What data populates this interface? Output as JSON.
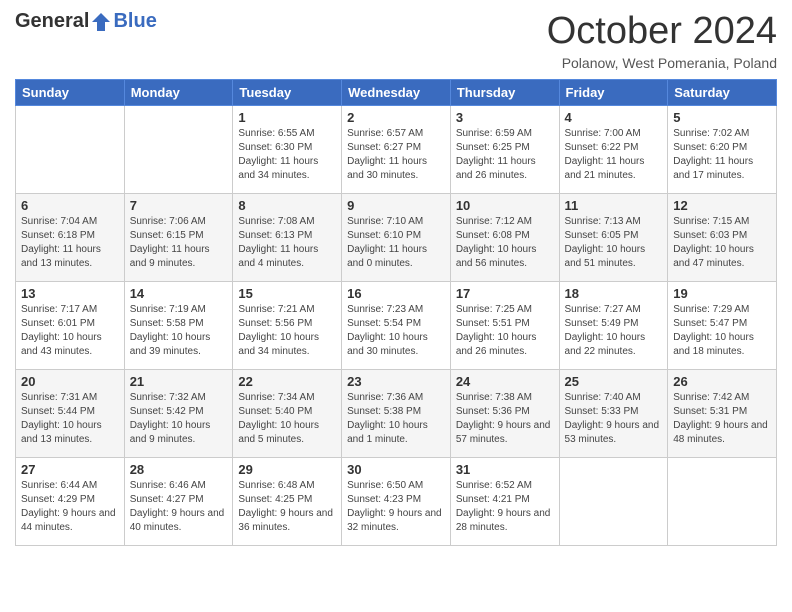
{
  "header": {
    "logo_general": "General",
    "logo_blue": "Blue",
    "month_title": "October 2024",
    "location": "Polanow, West Pomerania, Poland"
  },
  "days_of_week": [
    "Sunday",
    "Monday",
    "Tuesday",
    "Wednesday",
    "Thursday",
    "Friday",
    "Saturday"
  ],
  "weeks": [
    [
      {
        "day": "",
        "info": ""
      },
      {
        "day": "",
        "info": ""
      },
      {
        "day": "1",
        "info": "Sunrise: 6:55 AM\nSunset: 6:30 PM\nDaylight: 11 hours and 34 minutes."
      },
      {
        "day": "2",
        "info": "Sunrise: 6:57 AM\nSunset: 6:27 PM\nDaylight: 11 hours and 30 minutes."
      },
      {
        "day": "3",
        "info": "Sunrise: 6:59 AM\nSunset: 6:25 PM\nDaylight: 11 hours and 26 minutes."
      },
      {
        "day": "4",
        "info": "Sunrise: 7:00 AM\nSunset: 6:22 PM\nDaylight: 11 hours and 21 minutes."
      },
      {
        "day": "5",
        "info": "Sunrise: 7:02 AM\nSunset: 6:20 PM\nDaylight: 11 hours and 17 minutes."
      }
    ],
    [
      {
        "day": "6",
        "info": "Sunrise: 7:04 AM\nSunset: 6:18 PM\nDaylight: 11 hours and 13 minutes."
      },
      {
        "day": "7",
        "info": "Sunrise: 7:06 AM\nSunset: 6:15 PM\nDaylight: 11 hours and 9 minutes."
      },
      {
        "day": "8",
        "info": "Sunrise: 7:08 AM\nSunset: 6:13 PM\nDaylight: 11 hours and 4 minutes."
      },
      {
        "day": "9",
        "info": "Sunrise: 7:10 AM\nSunset: 6:10 PM\nDaylight: 11 hours and 0 minutes."
      },
      {
        "day": "10",
        "info": "Sunrise: 7:12 AM\nSunset: 6:08 PM\nDaylight: 10 hours and 56 minutes."
      },
      {
        "day": "11",
        "info": "Sunrise: 7:13 AM\nSunset: 6:05 PM\nDaylight: 10 hours and 51 minutes."
      },
      {
        "day": "12",
        "info": "Sunrise: 7:15 AM\nSunset: 6:03 PM\nDaylight: 10 hours and 47 minutes."
      }
    ],
    [
      {
        "day": "13",
        "info": "Sunrise: 7:17 AM\nSunset: 6:01 PM\nDaylight: 10 hours and 43 minutes."
      },
      {
        "day": "14",
        "info": "Sunrise: 7:19 AM\nSunset: 5:58 PM\nDaylight: 10 hours and 39 minutes."
      },
      {
        "day": "15",
        "info": "Sunrise: 7:21 AM\nSunset: 5:56 PM\nDaylight: 10 hours and 34 minutes."
      },
      {
        "day": "16",
        "info": "Sunrise: 7:23 AM\nSunset: 5:54 PM\nDaylight: 10 hours and 30 minutes."
      },
      {
        "day": "17",
        "info": "Sunrise: 7:25 AM\nSunset: 5:51 PM\nDaylight: 10 hours and 26 minutes."
      },
      {
        "day": "18",
        "info": "Sunrise: 7:27 AM\nSunset: 5:49 PM\nDaylight: 10 hours and 22 minutes."
      },
      {
        "day": "19",
        "info": "Sunrise: 7:29 AM\nSunset: 5:47 PM\nDaylight: 10 hours and 18 minutes."
      }
    ],
    [
      {
        "day": "20",
        "info": "Sunrise: 7:31 AM\nSunset: 5:44 PM\nDaylight: 10 hours and 13 minutes."
      },
      {
        "day": "21",
        "info": "Sunrise: 7:32 AM\nSunset: 5:42 PM\nDaylight: 10 hours and 9 minutes."
      },
      {
        "day": "22",
        "info": "Sunrise: 7:34 AM\nSunset: 5:40 PM\nDaylight: 10 hours and 5 minutes."
      },
      {
        "day": "23",
        "info": "Sunrise: 7:36 AM\nSunset: 5:38 PM\nDaylight: 10 hours and 1 minute."
      },
      {
        "day": "24",
        "info": "Sunrise: 7:38 AM\nSunset: 5:36 PM\nDaylight: 9 hours and 57 minutes."
      },
      {
        "day": "25",
        "info": "Sunrise: 7:40 AM\nSunset: 5:33 PM\nDaylight: 9 hours and 53 minutes."
      },
      {
        "day": "26",
        "info": "Sunrise: 7:42 AM\nSunset: 5:31 PM\nDaylight: 9 hours and 48 minutes."
      }
    ],
    [
      {
        "day": "27",
        "info": "Sunrise: 6:44 AM\nSunset: 4:29 PM\nDaylight: 9 hours and 44 minutes."
      },
      {
        "day": "28",
        "info": "Sunrise: 6:46 AM\nSunset: 4:27 PM\nDaylight: 9 hours and 40 minutes."
      },
      {
        "day": "29",
        "info": "Sunrise: 6:48 AM\nSunset: 4:25 PM\nDaylight: 9 hours and 36 minutes."
      },
      {
        "day": "30",
        "info": "Sunrise: 6:50 AM\nSunset: 4:23 PM\nDaylight: 9 hours and 32 minutes."
      },
      {
        "day": "31",
        "info": "Sunrise: 6:52 AM\nSunset: 4:21 PM\nDaylight: 9 hours and 28 minutes."
      },
      {
        "day": "",
        "info": ""
      },
      {
        "day": "",
        "info": ""
      }
    ]
  ]
}
